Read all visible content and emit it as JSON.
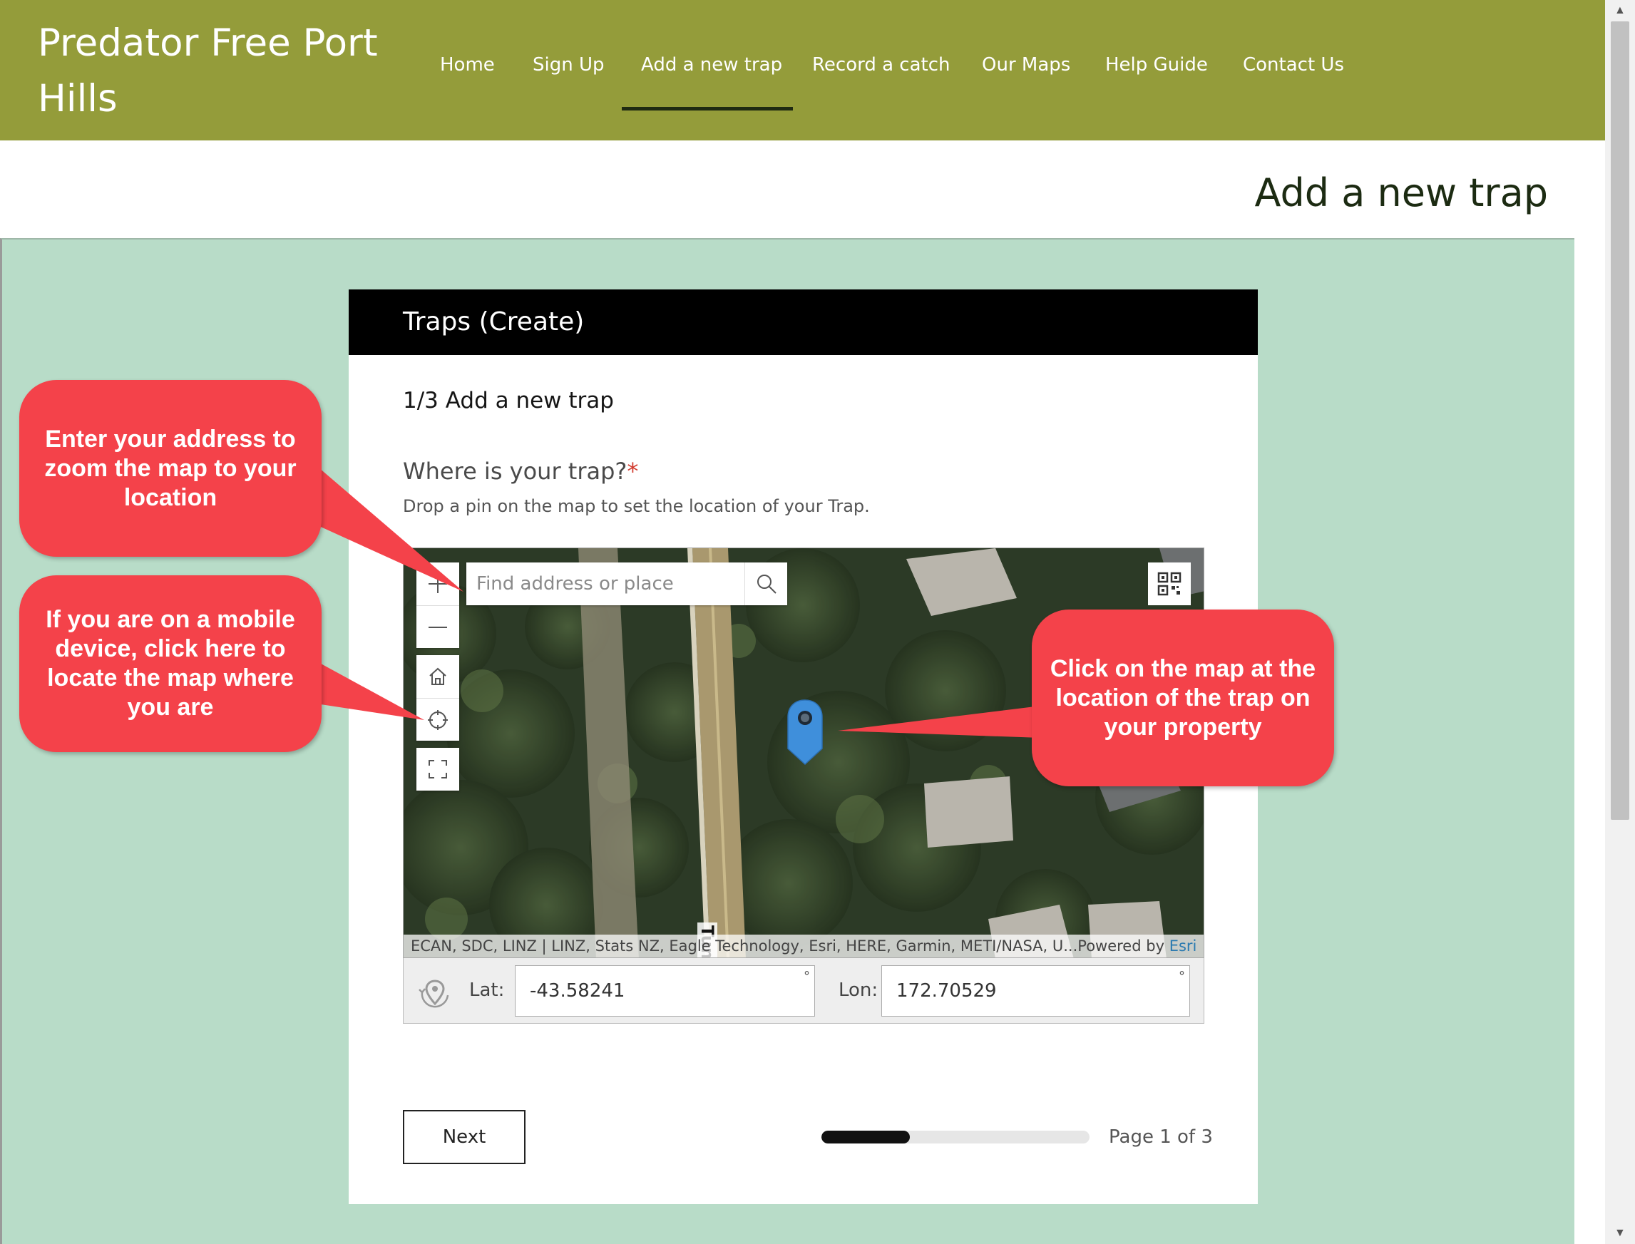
{
  "site": {
    "title": "Predator Free Port Hills"
  },
  "nav": {
    "items": [
      {
        "label": "Home"
      },
      {
        "label": "Sign Up"
      },
      {
        "label": "Add a new trap",
        "active": true
      },
      {
        "label": "Record a catch"
      },
      {
        "label": "Our Maps"
      },
      {
        "label": "Help Guide"
      },
      {
        "label": "Contact Us"
      }
    ]
  },
  "page": {
    "title": "Add a new trap"
  },
  "form": {
    "header": "Traps (Create)",
    "section_title": "1/3 Add a new trap",
    "question": "Where is your trap?",
    "required_mark": "*",
    "hint": "Drop a pin on the map to set the location of your Trap.",
    "map": {
      "search_placeholder": "Find address or place",
      "road_label": "Tunnel Rd",
      "attribution": "ECAN, SDC, LINZ | LINZ, Stats NZ, Eagle Technology, Esri, HERE, Garmin, METI/NASA, U...",
      "powered_by": "Powered by",
      "powered_by_link": "Esri",
      "icons": [
        "zoom-in-icon",
        "zoom-out-icon",
        "home-icon",
        "locate-icon",
        "fullscreen-icon",
        "search-icon",
        "qr-code-icon",
        "map-pin-icon"
      ]
    },
    "coords": {
      "lat_label": "Lat:",
      "lat_value": "-43.58241",
      "lon_label": "Lon:",
      "lon_value": "172.70529",
      "degree_symbol": "°"
    },
    "next_label": "Next",
    "progress": {
      "fraction": 0.33,
      "text": "Page 1 of 3"
    }
  },
  "callouts": {
    "address": "Enter your address to zoom the map to your location",
    "mobile": "If you are on a mobile device, click here to locate the map where you are",
    "click_map": "Click on the map at the location of the trap on your property"
  },
  "colors": {
    "header": "#949c3a",
    "content_bg": "#b8dcc8",
    "callout": "#f4424a",
    "pin": "#3f8fdb",
    "required": "#d23b2e"
  }
}
